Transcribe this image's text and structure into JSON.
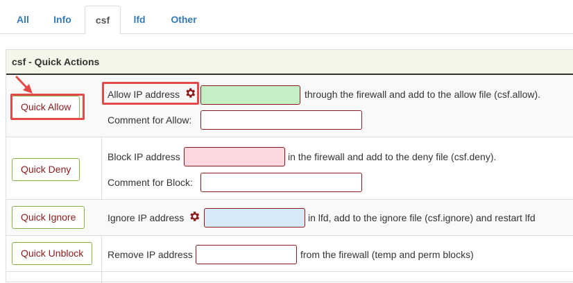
{
  "tabs": [
    {
      "label": "All",
      "active": false
    },
    {
      "label": "Info",
      "active": false
    },
    {
      "label": "csf",
      "active": true
    },
    {
      "label": "lfd",
      "active": false
    },
    {
      "label": "Other",
      "active": false
    }
  ],
  "panel": {
    "title": "csf - Quick Actions"
  },
  "quick_allow": {
    "button": "Quick Allow",
    "label": "Allow IP address",
    "suffix": "through the firewall and add to the allow file (csf.allow).",
    "ip_value": "",
    "comment_label": "Comment for Allow:",
    "comment_value": ""
  },
  "quick_deny": {
    "button": "Quick Deny",
    "label": "Block IP address",
    "suffix": "in the firewall and add to the deny file (csf.deny).",
    "ip_value": "",
    "comment_label": "Comment for Block:",
    "comment_value": ""
  },
  "quick_ignore": {
    "button": "Quick Ignore",
    "label": "Ignore IP address",
    "suffix": "in lfd, add to the ignore file (csf.ignore) and restart lfd",
    "ip_value": ""
  },
  "quick_unblock": {
    "button": "Quick Unblock",
    "label": "Remove IP address",
    "suffix": "from the firewall (temp and perm blocks)",
    "ip_value": ""
  },
  "icons": {
    "gear": "gear-icon",
    "arrow": "red-arrow-annotation"
  },
  "colors": {
    "tab_link": "#337ab7",
    "button_text": "#8b1a1a",
    "button_border": "#8ab04a",
    "input_border": "#8b1a1a",
    "allow_input_bg": "#c4eec6",
    "deny_input_bg": "#fdd7df",
    "ignore_input_bg": "#d6e9f7",
    "highlight": "#e54848",
    "gear": "#8b1a1a"
  }
}
